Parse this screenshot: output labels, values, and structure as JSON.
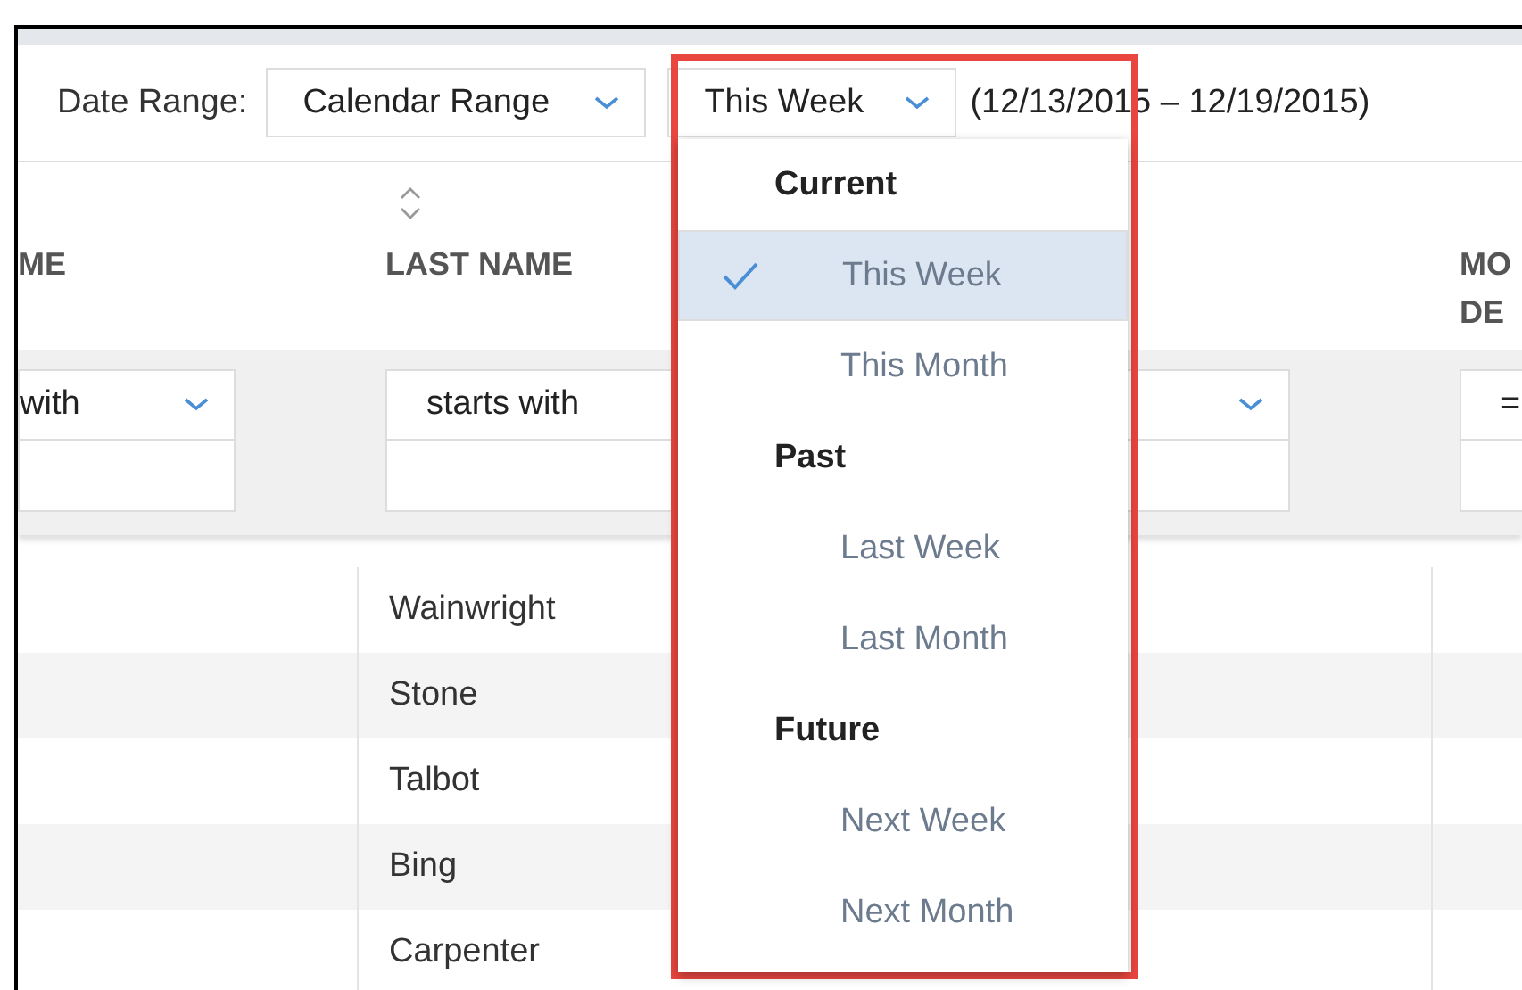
{
  "toolbar": {
    "label": "Date Range:",
    "range_type": "Calendar Range",
    "period": "This Week",
    "dates": "(12/13/2015 – 12/19/2015)"
  },
  "table": {
    "columns": [
      {
        "lines": [
          "ME"
        ],
        "filter": {
          "kind": "select",
          "value": "with"
        }
      },
      {
        "lines": [
          "LAST NAME"
        ],
        "sortable": true,
        "filter": {
          "kind": "text",
          "value": "starts with"
        }
      },
      {
        "filter": {
          "kind": "select"
        }
      },
      {
        "lines": [
          "MO",
          "DE"
        ],
        "filter": {
          "kind": "text",
          "value": "="
        }
      }
    ],
    "rows": [
      {
        "last_name": "Wainwright"
      },
      {
        "last_name": "Stone"
      },
      {
        "last_name": "Talbot"
      },
      {
        "last_name": "Bing"
      },
      {
        "last_name": "Carpenter"
      }
    ]
  },
  "period_menu": {
    "highlighted": true,
    "groups": [
      {
        "heading": "Current",
        "items": [
          {
            "label": "This Week",
            "selected": true
          },
          {
            "label": "This Month",
            "selected": false
          }
        ]
      },
      {
        "heading": "Past",
        "items": [
          {
            "label": "Last Week",
            "selected": false
          },
          {
            "label": "Last Month",
            "selected": false
          }
        ]
      },
      {
        "heading": "Future",
        "items": [
          {
            "label": "Next Week",
            "selected": false
          },
          {
            "label": "Next Month",
            "selected": false
          }
        ]
      }
    ]
  }
}
